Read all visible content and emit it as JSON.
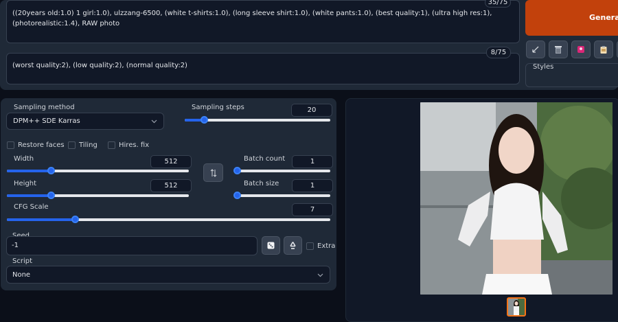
{
  "prompt": {
    "text": "((20years old:1.0) 1 girl:1.0), ulzzang-6500, (white t-shirts:1.0), (long sleeve shirt:1.0), (white pants:1.0), (best quality:1), (ultra high res:1), (photorealistic:1.4), RAW photo",
    "token_count": "35/75"
  },
  "negative_prompt": {
    "text": "(worst quality:2), (low quality:2), (normal quality:2)",
    "token_count": "8/75"
  },
  "generate_button": {
    "label": "Generate"
  },
  "styles": {
    "label": "Styles"
  },
  "tool_icons": [
    "arrow-icon",
    "trash-icon",
    "extra-networks-icon",
    "clipboard-icon"
  ],
  "sampling_method": {
    "label": "Sampling method",
    "value": "DPM++ SDE Karras"
  },
  "sampling_steps": {
    "label": "Sampling steps",
    "value": "20",
    "fraction": 0.13
  },
  "checkboxes": {
    "restore_faces": "Restore faces",
    "tiling": "Tiling",
    "hires_fix": "Hires. fix"
  },
  "width": {
    "label": "Width",
    "value": "512",
    "fraction": 0.24
  },
  "height": {
    "label": "Height",
    "value": "512",
    "fraction": 0.24
  },
  "batch_count": {
    "label": "Batch count",
    "value": "1",
    "fraction": 0.0
  },
  "batch_size": {
    "label": "Batch size",
    "value": "1",
    "fraction": 0.0
  },
  "cfg_scale": {
    "label": "CFG Scale",
    "value": "7",
    "fraction": 0.21
  },
  "seed": {
    "label": "Seed",
    "value": "-1",
    "extra_label": "Extra"
  },
  "script": {
    "label": "Script",
    "value": "None"
  },
  "colors": {
    "accent": "#2563eb",
    "generate": "#c2410c",
    "background": "#0b0f19",
    "panel": "#1f2937"
  }
}
